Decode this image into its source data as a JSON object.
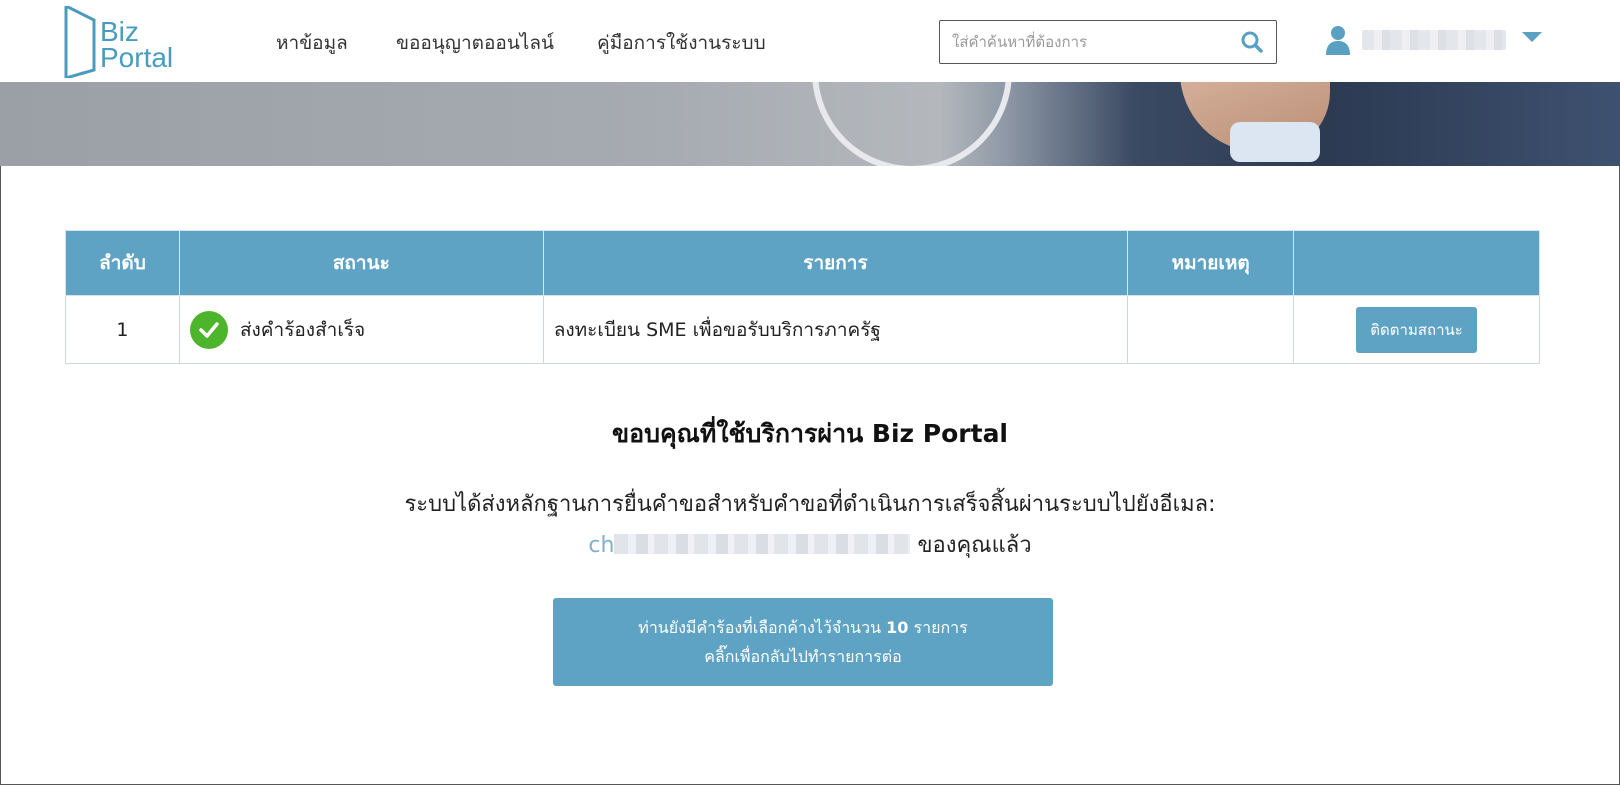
{
  "header": {
    "logo": {
      "line1": "Biz",
      "line2": "Portal"
    },
    "nav": [
      {
        "label": "หาข้อมูล"
      },
      {
        "label": "ขออนุญาตออนไลน์"
      },
      {
        "label": "คู่มือการใช้งานระบบ"
      }
    ],
    "search": {
      "placeholder": "ใส่คำค้นหาที่ต้องการ",
      "icon": "search-icon"
    },
    "user": {
      "icon": "user-icon",
      "menu_icon": "caret-down-icon"
    }
  },
  "table": {
    "headers": [
      "ลำดับ",
      "สถานะ",
      "รายการ",
      "หมายเหตุ",
      ""
    ],
    "rows": [
      {
        "index": "1",
        "status": "ส่งคำร้องสำเร็จ",
        "item": "ลงทะเบียน SME เพื่อขอรับบริการภาครัฐ",
        "note": "",
        "action": "ติดตามสถานะ"
      }
    ]
  },
  "confirmation": {
    "title": "ขอบคุณที่ใช้บริการผ่าน Biz Portal",
    "message": "ระบบได้ส่งหลักฐานการยื่นคำขอสำหรับคำขอที่ดำเนินการเสร็จสิ้นผ่านระบบไปยังอีเมล:",
    "email_prefix": "ch",
    "suffix": "ของคุณแล้ว"
  },
  "pending": {
    "line1_prefix": "ท่านยังมีคำร้องที่เลือกค้างไว้จำนวน",
    "count": "10",
    "line1_suffix": "รายการ",
    "line2": "คลิ๊กเพื่อกลับไปทำรายการต่อ"
  },
  "colors": {
    "accent": "#5ea3c4",
    "success": "#4cb52b",
    "logo": "#4a9bbd"
  }
}
